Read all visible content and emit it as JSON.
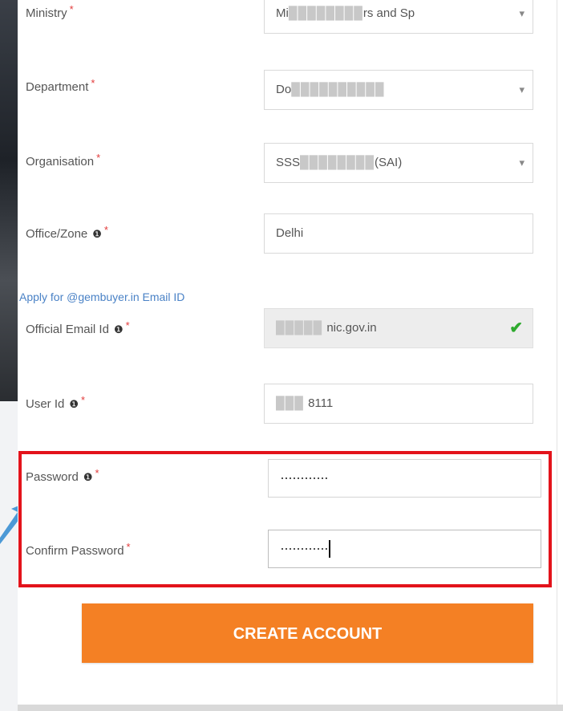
{
  "form": {
    "ministry": {
      "label": "Ministry",
      "value_visible": "Mi",
      "value_tail": "rs and Sp"
    },
    "department": {
      "label": "Department",
      "value_visible": "Do"
    },
    "organisation": {
      "label": "Organisation",
      "value_visible": "SSS",
      "value_tail": "(SAI)"
    },
    "office_zone": {
      "label": "Office/Zone",
      "value": "Delhi"
    },
    "apply_link": "Apply for @gembuyer.in Email ID",
    "official_email": {
      "label": "Official Email Id",
      "value_tail": "nic.gov.in"
    },
    "user_id": {
      "label": "User Id",
      "value_tail": "8111"
    },
    "password": {
      "label": "Password",
      "value": "············"
    },
    "confirm_password": {
      "label": "Confirm Password",
      "value": "············"
    },
    "required_mark": "*",
    "create_button": "CREATE ACCOUNT"
  },
  "icons": {
    "dropdown": "chevron-down-icon",
    "info": "info-circle-icon",
    "verified": "checkmark-icon"
  },
  "colors": {
    "required": "#e23b3b",
    "link": "#4a82c6",
    "highlight_box": "#e3131b",
    "button_bg": "#f48024",
    "check": "#2eaa2e"
  }
}
